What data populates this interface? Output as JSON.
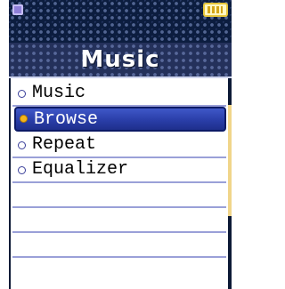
{
  "status_bar": {
    "left_icon": "menu-icon",
    "right_icon": "battery-icon"
  },
  "header": {
    "title": "Music"
  },
  "menu": {
    "items": [
      {
        "label": "Music",
        "selected": false
      },
      {
        "label": "Browse",
        "selected": true
      },
      {
        "label": "Repeat",
        "selected": false
      },
      {
        "label": "Equalizer",
        "selected": false
      }
    ]
  },
  "colors": {
    "title_bar": "#24315b",
    "selection": "#2a3ea8",
    "battery": "#e6c63a",
    "bullet_selected": "#f3b51c"
  }
}
